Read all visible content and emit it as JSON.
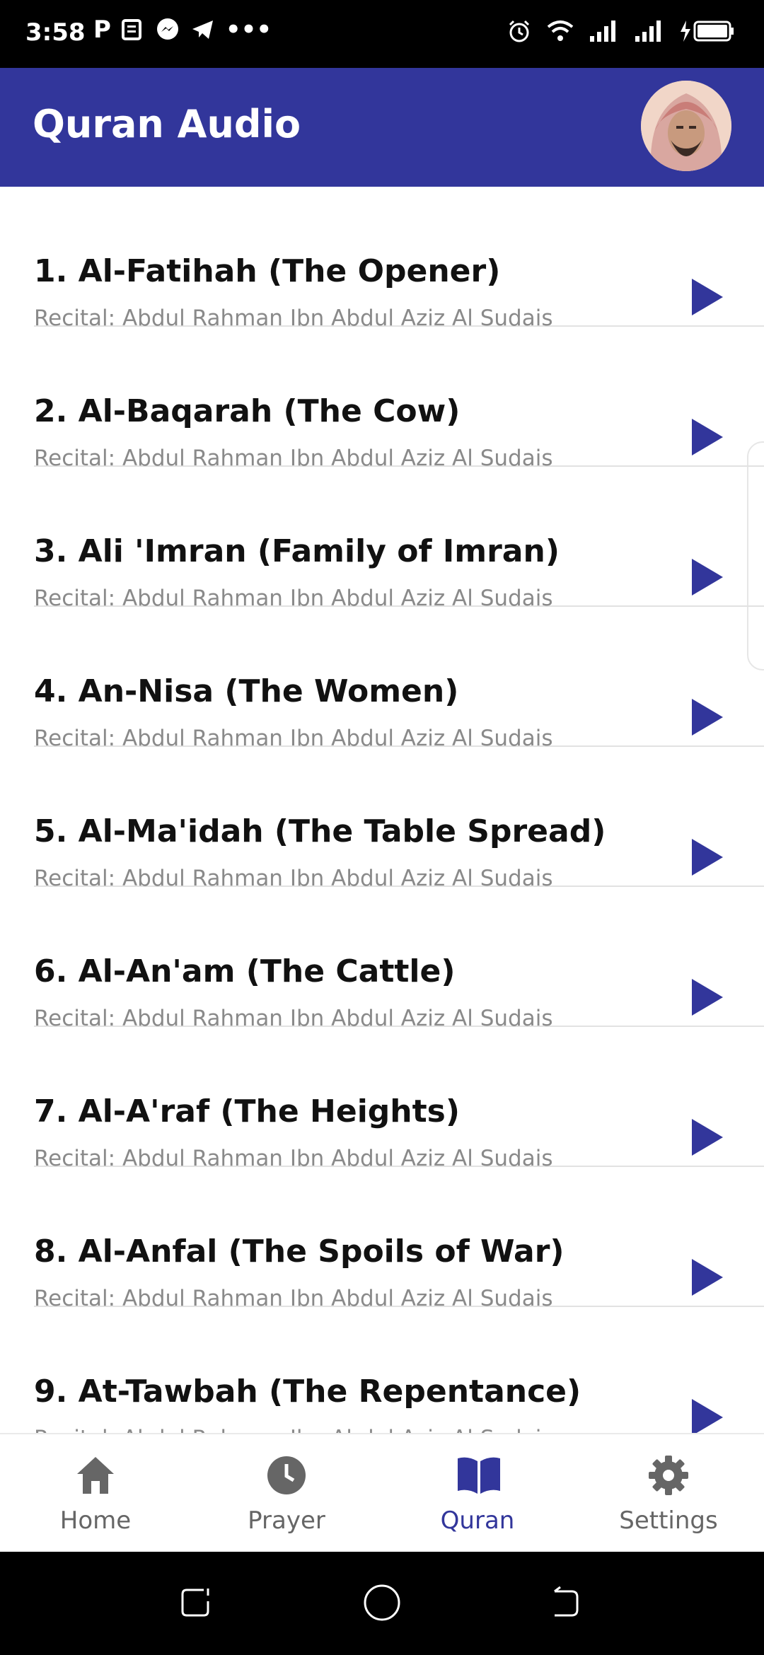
{
  "status_bar": {
    "time": "3:58"
  },
  "app_bar": {
    "title": "Quran Audio"
  },
  "surahs": [
    {
      "title": "1. Al-Fatihah (The Opener)",
      "subtitle": "Recital: Abdul Rahman Ibn Abdul Aziz Al Sudais"
    },
    {
      "title": "2. Al-Baqarah (The Cow)",
      "subtitle": "Recital: Abdul Rahman Ibn Abdul Aziz Al Sudais"
    },
    {
      "title": "3. Ali 'Imran (Family of Imran)",
      "subtitle": "Recital: Abdul Rahman Ibn Abdul Aziz Al Sudais"
    },
    {
      "title": "4. An-Nisa (The Women)",
      "subtitle": "Recital: Abdul Rahman Ibn Abdul Aziz Al Sudais"
    },
    {
      "title": "5. Al-Ma'idah (The Table Spread)",
      "subtitle": "Recital: Abdul Rahman Ibn Abdul Aziz Al Sudais"
    },
    {
      "title": "6. Al-An'am (The Cattle)",
      "subtitle": "Recital: Abdul Rahman Ibn Abdul Aziz Al Sudais"
    },
    {
      "title": "7. Al-A'raf (The Heights)",
      "subtitle": "Recital: Abdul Rahman Ibn Abdul Aziz Al Sudais"
    },
    {
      "title": "8. Al-Anfal (The Spoils of War)",
      "subtitle": "Recital: Abdul Rahman Ibn Abdul Aziz Al Sudais"
    },
    {
      "title": "9. At-Tawbah (The Repentance)",
      "subtitle": "Recital: Abdul Rahman Ibn Abdul Aziz Al Sudais"
    }
  ],
  "bottom_nav": {
    "home": "Home",
    "prayer": "Prayer",
    "quran": "Quran",
    "settings": "Settings",
    "active": "quran"
  },
  "colors": {
    "primary": "#32369b",
    "play": "#32369b",
    "muted": "#8a8a8a"
  }
}
